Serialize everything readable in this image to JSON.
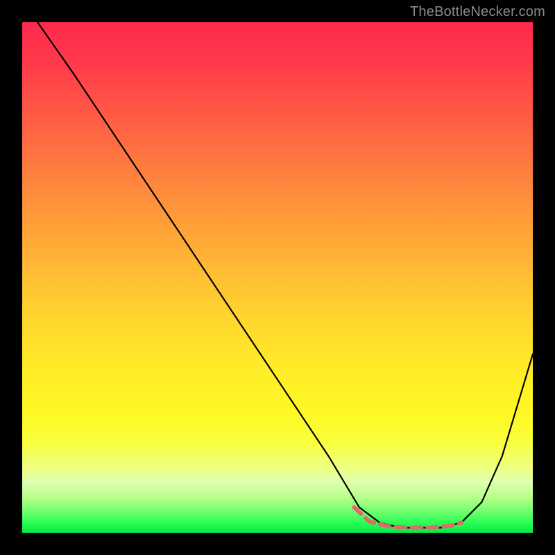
{
  "watermark": "TheBottleNecker.com",
  "chart_data": {
    "type": "line",
    "title": "",
    "xlabel": "",
    "ylabel": "",
    "xlim": [
      0,
      100
    ],
    "ylim": [
      0,
      100
    ],
    "grid": false,
    "series": [
      {
        "name": "curve",
        "color": "#000000",
        "x": [
          3,
          10,
          20,
          30,
          40,
          50,
          60,
          66,
          70,
          74,
          78,
          82,
          86,
          90,
          94,
          100
        ],
        "y": [
          100,
          90,
          75,
          60,
          45,
          30,
          15,
          5,
          2,
          1,
          1,
          1,
          2,
          6,
          15,
          35
        ]
      }
    ],
    "highlight": {
      "name": "optimal-range",
      "color": "#e06a6a",
      "stroke_width": 6,
      "x": [
        65,
        68,
        72,
        76,
        80,
        84,
        86
      ],
      "y": [
        5,
        2.2,
        1.2,
        1,
        1,
        1.4,
        2
      ]
    }
  }
}
